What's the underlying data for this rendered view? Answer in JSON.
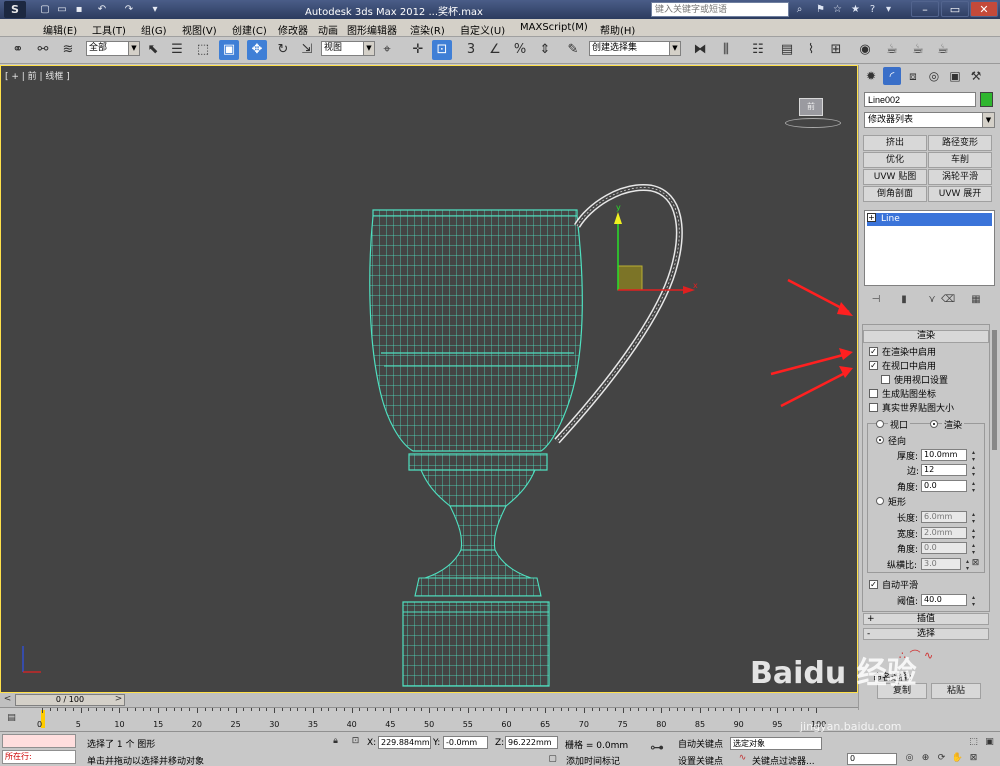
{
  "window": {
    "title": "Autodesk 3ds Max  2012 ...奖杯.max",
    "search_placeholder": "键入关键字或短语"
  },
  "menu": [
    "编辑(E)",
    "工具(T)",
    "组(G)",
    "视图(V)",
    "创建(C)",
    "修改器",
    "动画",
    "图形编辑器",
    "渲染(R)",
    "自定义(U)",
    "MAXScript(M)",
    "帮助(H)"
  ],
  "toolbar": {
    "filter_select": "全部",
    "reference_select": "视图",
    "selection_set": "创建选择集"
  },
  "viewport": {
    "label": "[ + | 前 | 线框 ]",
    "viewcube_label": "前"
  },
  "command_panel": {
    "object_name": "Line002",
    "object_color": "#2fb62f",
    "modifier_list": "修改器列表",
    "modifier_buttons": [
      "挤出",
      "路径变形",
      "优化",
      "车削",
      "UVW 贴图",
      "涡轮平滑",
      "倒角剖面",
      "UVW 展开"
    ],
    "stack_item": "Line",
    "rendering": {
      "header": "渲染",
      "enable_in_renderer": "在渲染中启用",
      "enable_in_viewport": "在视口中启用",
      "use_viewport_settings": "使用视口设置",
      "generate_mapping": "生成贴图坐标",
      "real_world_map": "真实世界贴图大小",
      "viewport_radio": "视口",
      "render_radio": "渲染",
      "radial": "径向",
      "thickness_label": "厚度:",
      "thickness_value": "10.0mm",
      "sides_label": "边:",
      "sides_value": "12",
      "angle_label": "角度:",
      "angle_value": "0.0",
      "rectangular": "矩形",
      "length_label": "长度:",
      "length_value": "6.0mm",
      "width_label": "宽度:",
      "width_value": "2.0mm",
      "rect_angle_label": "角度:",
      "rect_angle_value": "0.0",
      "aspect_label": "纵横比:",
      "aspect_value": "3.0",
      "auto_smooth": "自动平滑",
      "threshold_label": "阈值:",
      "threshold_value": "40.0"
    },
    "interpolation": "插值",
    "selection": "选择",
    "named_selection": "命名选择:",
    "paste_button": "粘贴",
    "copy_partial": "复制"
  },
  "timeline": {
    "slider": "0 / 100",
    "ticks": [
      "0",
      "5",
      "10",
      "15",
      "20",
      "25",
      "30",
      "35",
      "40",
      "45",
      "50",
      "55",
      "60",
      "65",
      "70",
      "75",
      "80",
      "85",
      "90",
      "95",
      "100"
    ]
  },
  "status": {
    "maxscript_text": "所在行:",
    "message1": "选择了 1 个 图形",
    "message2": "单击并拖动以选择并移动对象",
    "x_label": "X:",
    "x_value": "229.884mm",
    "y_label": "Y:",
    "y_value": "-0.0mm",
    "z_label": "Z:",
    "z_value": "96.222mm",
    "grid": "栅格 = 0.0mm",
    "auto_key": "自动关键点",
    "set_key": "设置关键点",
    "key_mode": "选定对象",
    "add_time_tag": "添加时间标记",
    "key_filters": "关键点过滤器...",
    "frame": "0"
  },
  "watermark": {
    "brand": "Baidu 经验",
    "url": "jingyan.baidu.com"
  },
  "colors": {
    "wire": "#4fe0c0",
    "handle": "#e8e8e8",
    "annotation": "#ff2020"
  }
}
